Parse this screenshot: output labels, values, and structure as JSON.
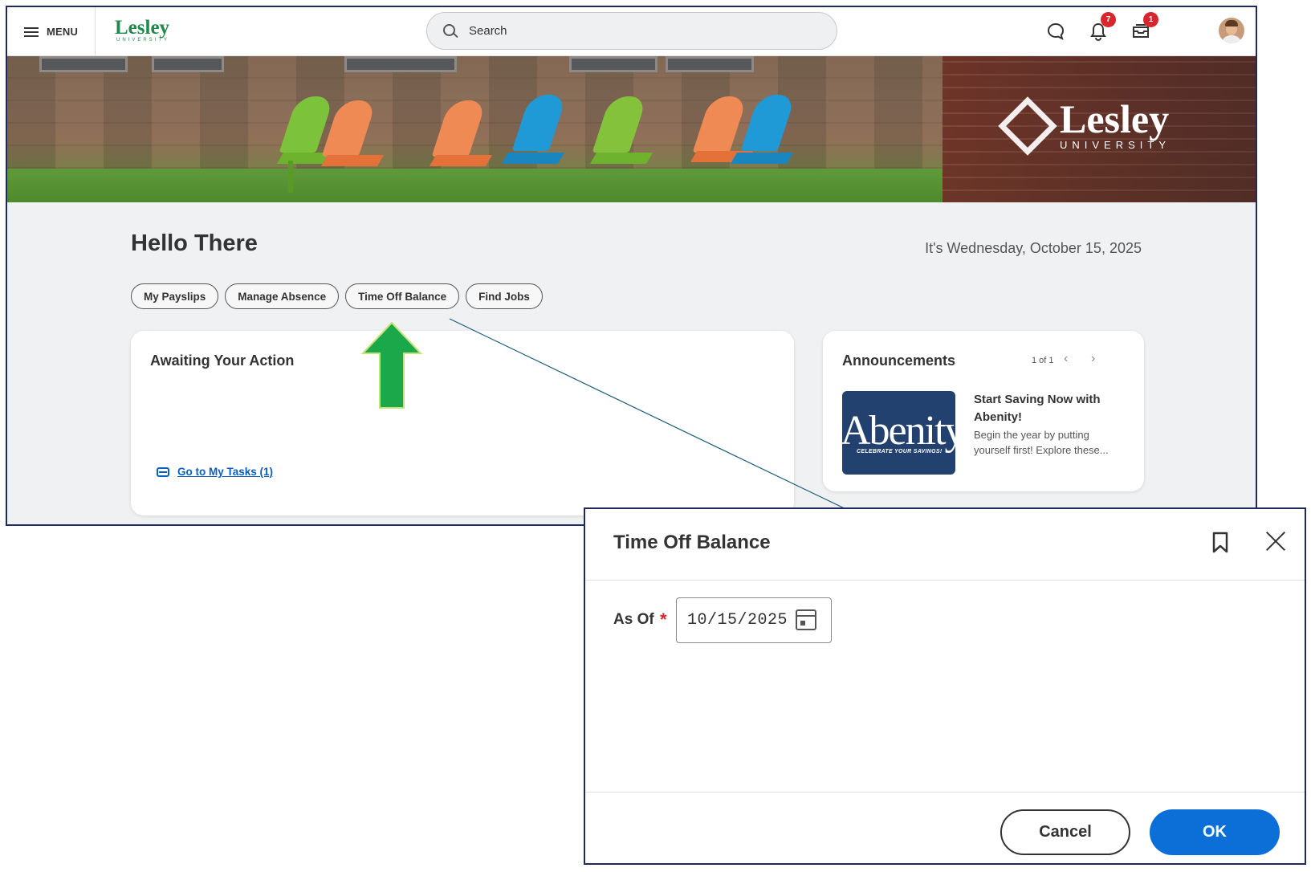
{
  "topbar": {
    "menu_label": "MENU",
    "logo_word": "Lesley",
    "logo_sub": "UNIVERSITY",
    "search_placeholder": "Search",
    "notifications_count": "7",
    "inbox_count": "1"
  },
  "banner": {
    "logo_word": "Lesley",
    "logo_sub": "UNIVERSITY"
  },
  "home": {
    "greeting": "Hello There",
    "date": "It's Wednesday, October 15, 2025",
    "quick_links": [
      "My Payslips",
      "Manage Absence",
      "Time Off Balance",
      "Find Jobs"
    ]
  },
  "awaiting": {
    "title": "Awaiting Your Action",
    "tasks_link": "Go to My Tasks (1)"
  },
  "announcements": {
    "title": "Announcements",
    "pager": "1 of 1",
    "image_brand": "Abenity",
    "image_tagline": "CELEBRATE YOUR SAVINGS!",
    "headline": "Start Saving Now with Abenity!",
    "body": "Begin the year by putting yourself first! Explore these..."
  },
  "dialog": {
    "title": "Time Off Balance",
    "field_label": "As Of",
    "required_mark": "*",
    "date_value": "10/15/2025",
    "cancel_label": "Cancel",
    "ok_label": "OK"
  },
  "colors": {
    "brand_green": "#1e8a4b",
    "link_blue": "#0b5ec2",
    "primary_button": "#0b6fd7",
    "badge_red": "#d9262c",
    "annotation_arrow": "#1aa84b",
    "frame_navy": "#1f2a5c"
  }
}
